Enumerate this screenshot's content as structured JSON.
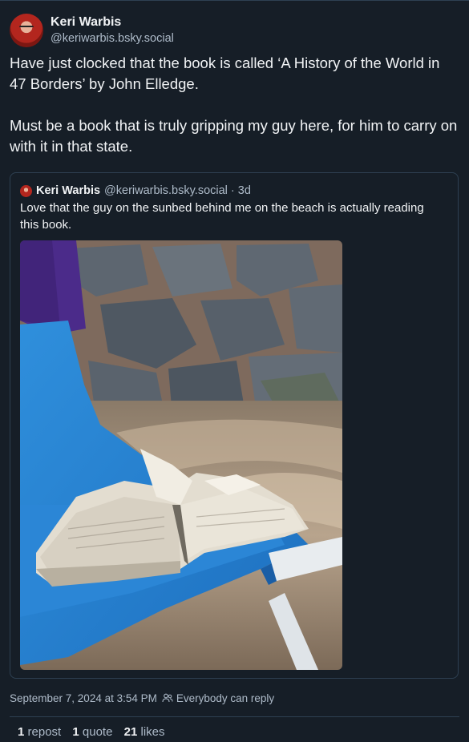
{
  "post": {
    "author": {
      "display_name": "Keri Warbis",
      "handle": "@keriwarbis.bsky.social"
    },
    "text": [
      "Have just clocked that the book is called ‘A History of the World in 47 Borders’ by John Elledge.",
      "Must be a book that is truly gripping my guy here, for him to carry on with it in that state."
    ],
    "timestamp": "September 7, 2024 at 3:54 PM",
    "reply_setting": "Everybody can reply"
  },
  "quoted_post": {
    "display_name": "Keri Warbis",
    "handle": "@keriwarbis.bsky.social",
    "separator": "·",
    "age": "3d",
    "text": "Love that the guy on the sunbed behind me on the beach is actually reading this book."
  },
  "stats": {
    "reposts_count": "1",
    "reposts_label": "repost",
    "quotes_count": "1",
    "quotes_label": "quote",
    "likes_count": "21",
    "likes_label": "likes"
  },
  "colors": {
    "background": "#161e27",
    "border": "#2e4052",
    "text": "#f1f3f5",
    "muted_text": "#aebbc9"
  }
}
